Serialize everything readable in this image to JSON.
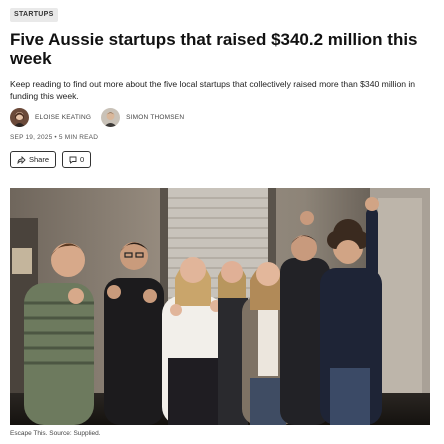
{
  "category": {
    "label": "STARTUPS"
  },
  "article": {
    "title": "Five Aussie startups that raised $340.2 million this week",
    "dek": "Keep reading to find out more about the five local startups that collectively raised more than $340 million in funding this week.",
    "authors": [
      {
        "name": "ELOISE KEATING"
      },
      {
        "name": "SIMON THOMSEN"
      }
    ],
    "meta": "SEP 19, 2025 • 5 MIN READ",
    "actions": {
      "share_label": "Share",
      "comments_count": "0"
    },
    "image": {
      "caption": "Escape This. Source: Supplied."
    }
  },
  "colors": {
    "text": "#111111",
    "tag_bg": "#e9e9e9",
    "border": "#333333"
  }
}
